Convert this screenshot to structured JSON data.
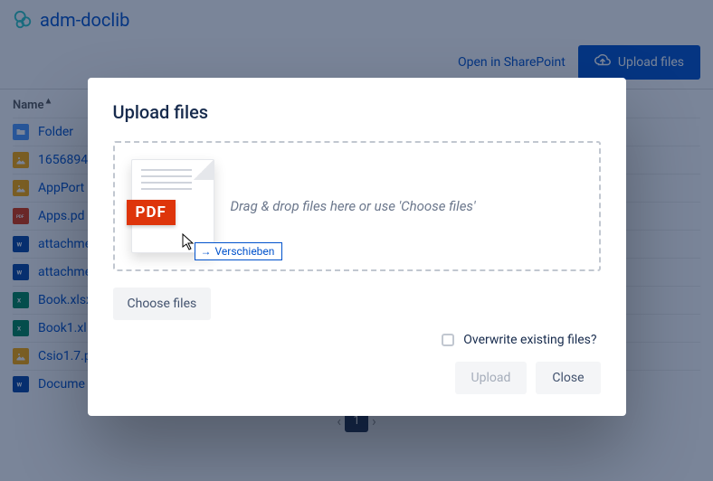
{
  "header": {
    "library_name": "adm-doclib"
  },
  "toolbar": {
    "sharepoint_link": "Open in SharePoint",
    "upload_button": "Upload files"
  },
  "columns": {
    "name": "Name",
    "sort_indicator": "▲"
  },
  "files": [
    {
      "icon": "folder",
      "name": "Folder"
    },
    {
      "icon": "img",
      "name": "1656894"
    },
    {
      "icon": "img",
      "name": "AppPort"
    },
    {
      "icon": "pdf",
      "name": "Apps.pd"
    },
    {
      "icon": "doc",
      "name": "attachme"
    },
    {
      "icon": "doc",
      "name": "attachme"
    },
    {
      "icon": "xls",
      "name": "Book.xlsx"
    },
    {
      "icon": "xls",
      "name": "Book1.xl"
    },
    {
      "icon": "img",
      "name": "Csio1.7.p"
    },
    {
      "icon": "doc",
      "name": "Docume"
    }
  ],
  "pager": {
    "current": "1"
  },
  "modal": {
    "title": "Upload files",
    "drop_hint": "Drag & drop files here or use 'Choose files'",
    "choose_button": "Choose files",
    "overwrite_label": "Overwrite existing files?",
    "upload_button": "Upload",
    "close_button": "Close",
    "drag_tooltip": "Verschieben",
    "thumb_label": "PDF"
  }
}
